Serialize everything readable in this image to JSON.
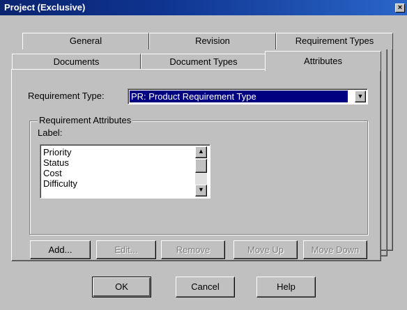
{
  "window": {
    "title": "Project (Exclusive)",
    "close_glyph": "×"
  },
  "tabs": {
    "back_row": [
      {
        "label": "General",
        "mnemonic": "G"
      },
      {
        "label": "Revision",
        "mnemonic": "v"
      },
      {
        "label": "Requirement Types",
        "mnemonic": ""
      }
    ],
    "front_row": [
      {
        "label": "Documents",
        "mnemonic": "o"
      },
      {
        "label": "Document Types",
        "mnemonic": "c"
      },
      {
        "label": "Attributes",
        "mnemonic": "b",
        "active": true
      }
    ]
  },
  "requirement_type": {
    "label": "Requirement Type:",
    "mnemonic": "T",
    "selected": "PR: Product Requirement Type"
  },
  "attributes_group": {
    "title": "Requirement Attributes",
    "list_label": "Label:",
    "items": [
      "Priority",
      "Status",
      "Cost",
      "Difficulty"
    ]
  },
  "action_buttons": [
    {
      "label": "Add...",
      "mnemonic": "A",
      "enabled": true
    },
    {
      "label": "Edit...",
      "mnemonic": "E",
      "enabled": false
    },
    {
      "label": "Remove",
      "mnemonic": "R",
      "enabled": false
    },
    {
      "label": "Move Up",
      "mnemonic": "U",
      "enabled": false
    },
    {
      "label": "Move Down",
      "mnemonic": "D",
      "enabled": false
    }
  ],
  "dialog_buttons": [
    {
      "label": "OK",
      "mnemonic": ""
    },
    {
      "label": "Cancel",
      "mnemonic": ""
    },
    {
      "label": "Help",
      "mnemonic": "H"
    }
  ],
  "colors": {
    "face": "#c0c0c0",
    "title_start": "#0a2470",
    "title_end": "#2a66c8",
    "selection": "#000080"
  },
  "icons": {
    "close": "close-icon",
    "dropdown": "chevron-down-icon",
    "scroll_up": "scroll-up-icon",
    "scroll_down": "scroll-down-icon"
  }
}
